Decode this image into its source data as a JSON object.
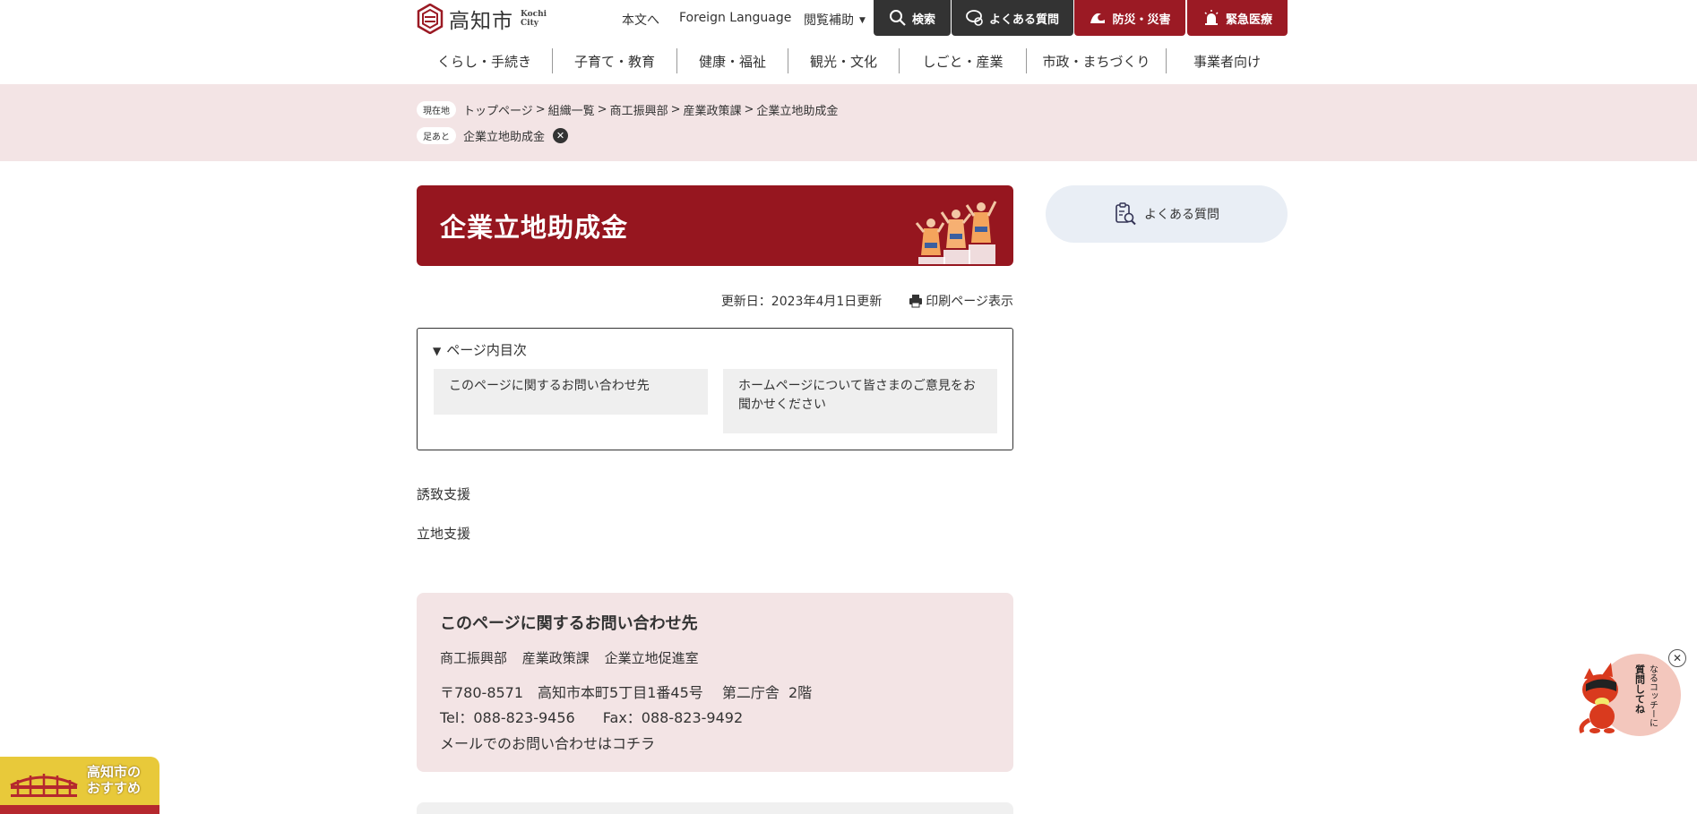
{
  "header": {
    "logo_ja": "高知市",
    "logo_en_line1": "Kochi",
    "logo_en_line2": "City",
    "util": {
      "main_text": "本文へ",
      "foreign_language": "Foreign Language",
      "accessibility": "閲覧補助"
    },
    "buttons": {
      "search": "検索",
      "faq": "よくある質問",
      "disaster": "防災・災害",
      "emergency": "緊急医療"
    },
    "colors": {
      "dark": "#333333",
      "brand_red": "#9b1a24"
    }
  },
  "global_nav": [
    "くらし・手続き",
    "子育て・教育",
    "健康・福祉",
    "観光・文化",
    "しごと・産業",
    "市政・まちづくり",
    "事業者向け"
  ],
  "breadcrumb": {
    "current_tag": "現在地",
    "items": [
      "トップページ",
      "組織一覧",
      "商工振興部",
      "産業政策課",
      "企業立地助成金"
    ],
    "separator": ">",
    "history_tag": "足あと",
    "history_item": "企業立地助成金"
  },
  "page": {
    "title": "企業立地助成金",
    "updated": "更新日：2023年4月1日更新",
    "print": "印刷ページ表示"
  },
  "toc": {
    "heading": "ページ内目次",
    "links": [
      "このページに関するお問い合わせ先",
      "ホームページについて皆さまのご意見をお聞かせください"
    ]
  },
  "sections": [
    "誘致支援",
    "立地支援"
  ],
  "contact": {
    "heading": "このページに関するお問い合わせ先",
    "dept": "商工振興部",
    "section": "産業政策課",
    "office": "企業立地促進室",
    "address": "〒780-8571　高知市本町5丁目1番45号",
    "building": "第二庁舎",
    "floor": "2階",
    "tel": "Tel：088-823-9456",
    "fax": "Fax：088-823-9492",
    "mail_link": "メールでのお問い合わせはコチラ"
  },
  "side": {
    "faq": "よくある質問"
  },
  "osusume": {
    "line1": "高知市の",
    "line2": "おすすめ"
  },
  "mascot": {
    "text_line1": "なるコッチーに",
    "text_line2": "質問してね"
  }
}
